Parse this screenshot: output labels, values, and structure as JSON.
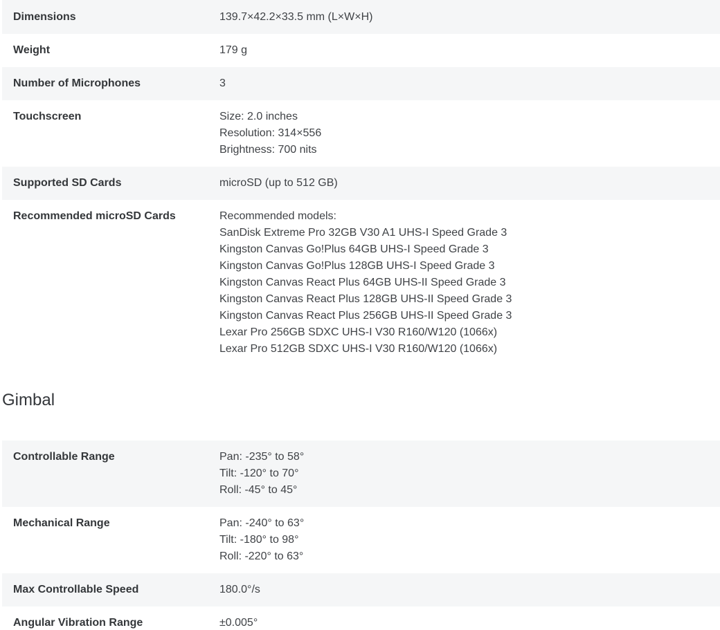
{
  "general_specs": [
    {
      "label": "Dimensions",
      "lines": [
        "139.7×42.2×33.5 mm (L×W×H)"
      ]
    },
    {
      "label": "Weight",
      "lines": [
        "179 g"
      ]
    },
    {
      "label": "Number of Microphones",
      "lines": [
        "3"
      ]
    },
    {
      "label": "Touchscreen",
      "lines": [
        "Size: 2.0 inches",
        "Resolution: 314×556",
        "Brightness: 700 nits"
      ]
    },
    {
      "label": "Supported SD Cards",
      "lines": [
        "microSD (up to 512 GB)"
      ]
    },
    {
      "label": "Recommended microSD Cards",
      "lines": [
        "Recommended models:",
        "SanDisk Extreme Pro 32GB V30 A1 UHS-I Speed Grade 3",
        "Kingston Canvas Go!Plus 64GB UHS-I Speed Grade 3",
        "Kingston Canvas Go!Plus 128GB UHS-I Speed Grade 3",
        "Kingston Canvas React Plus 64GB UHS-II Speed Grade 3",
        "Kingston Canvas React Plus 128GB UHS-II Speed Grade 3",
        "Kingston Canvas React Plus 256GB UHS-II Speed Grade 3",
        "Lexar Pro 256GB SDXC UHS-I V30 R160/W120 (1066x)",
        "Lexar Pro 512GB SDXC UHS-I V30 R160/W120 (1066x)"
      ]
    }
  ],
  "gimbal_section": {
    "heading": "Gimbal",
    "specs": [
      {
        "label": "Controllable Range",
        "lines": [
          "Pan: -235° to 58°",
          "Tilt: -120° to 70°",
          "Roll: -45° to 45°"
        ]
      },
      {
        "label": "Mechanical Range",
        "lines": [
          "Pan: -240° to 63°",
          "Tilt: -180° to 98°",
          "Roll: -220° to 63°"
        ]
      },
      {
        "label": "Max Controllable Speed",
        "lines": [
          "180.0°/s"
        ]
      },
      {
        "label": "Angular Vibration Range",
        "lines": [
          "±0.005°"
        ]
      }
    ]
  },
  "colors": {
    "row_shade": "#f5f6f7",
    "label_text": "#34373a",
    "value_text": "#3f4246"
  }
}
